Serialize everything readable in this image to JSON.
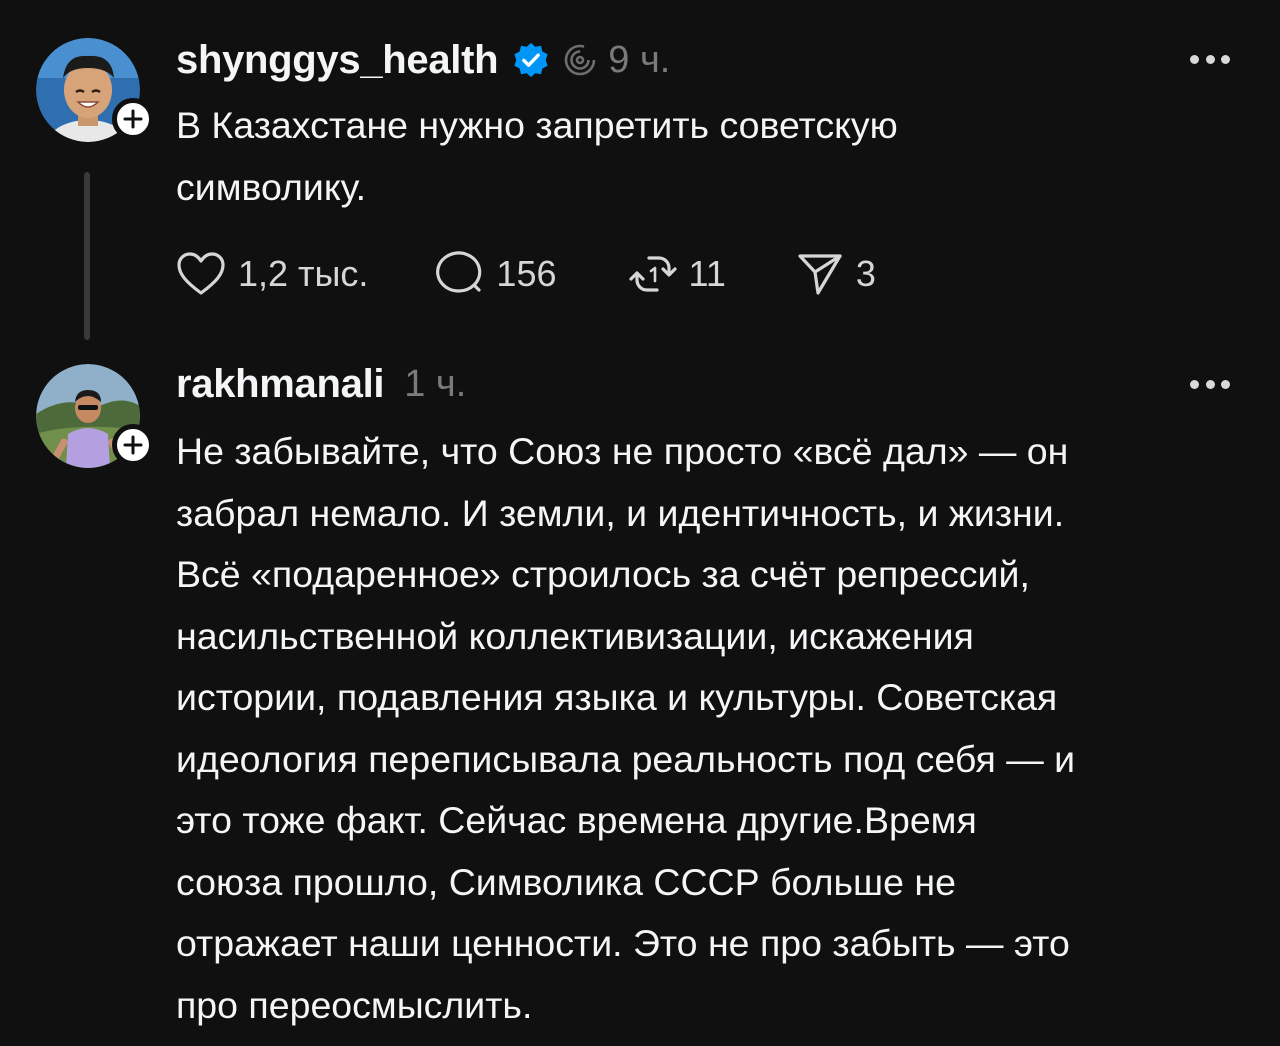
{
  "posts": [
    {
      "username": "shynggys_health",
      "verified": true,
      "time": "9 ч.",
      "lines": [
        "В Казахстане нужно запретить советскую",
        "символику."
      ],
      "stats": {
        "likes": "1,2 тыс.",
        "comments": "156",
        "reposts": "11",
        "shares": "3"
      }
    },
    {
      "username": "rakhmanali",
      "time": "1 ч.",
      "lines": [
        "Не забывайте, что Союз не просто «всё дал» — он",
        "забрал немало. И земли, и идентичность, и жизни.",
        "Всё «подаренное» строилось за счёт репрессий,",
        "насильственной коллективизации, искажения",
        "истории, подавления языка и культуры. Советская",
        "идеология переписывала реальность под себя — и",
        "это тоже факт. Сейчас времена другие.Время",
        "союза прошло,  Символика СССР больше не",
        "отражает наши ценности. Это не про забыть — это",
        "про переосмыслить."
      ]
    }
  ],
  "colors": {
    "background": "#101010",
    "text": "#f3f5f7",
    "muted": "#7a7a7a",
    "verified": "#0095f6"
  },
  "icons": [
    "more-icon",
    "verified-icon",
    "threads-spiral-icon",
    "heart-icon",
    "comment-icon",
    "repost-icon",
    "share-icon",
    "follow-plus-icon"
  ]
}
